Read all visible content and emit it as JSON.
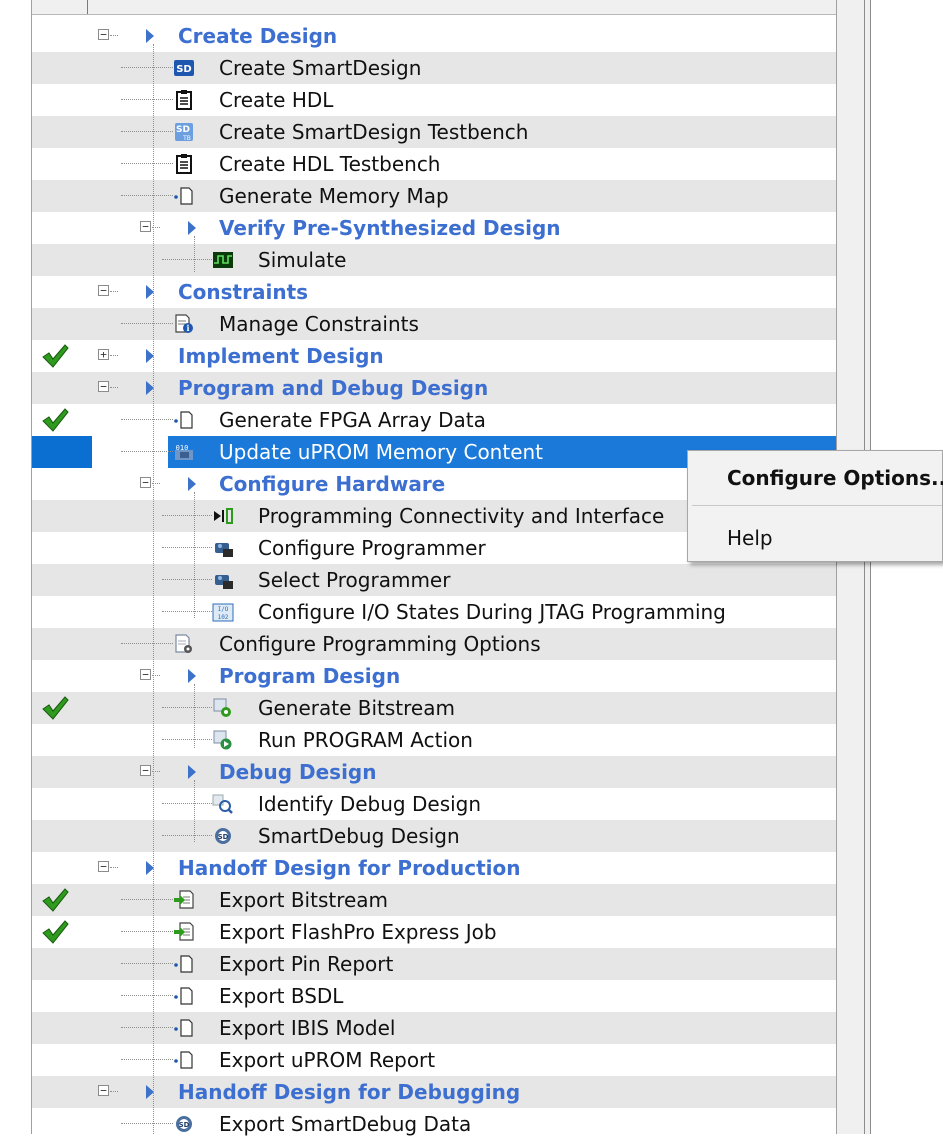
{
  "tree": {
    "rows": [
      {
        "id": "create-design",
        "label": "Create Design",
        "kind": "group",
        "icon": "caret-right-icon",
        "expander": "minus",
        "check": false
      },
      {
        "id": "create-smartdesign",
        "label": "Create SmartDesign",
        "kind": "item",
        "icon": "smartdesign-icon",
        "check": false
      },
      {
        "id": "create-hdl",
        "label": "Create HDL",
        "kind": "item",
        "icon": "clipboard-icon",
        "check": false
      },
      {
        "id": "create-smartdesign-testbench",
        "label": "Create SmartDesign Testbench",
        "kind": "item",
        "icon": "smartdesign-testbench-icon",
        "check": false
      },
      {
        "id": "create-hdl-testbench",
        "label": "Create HDL Testbench",
        "kind": "item",
        "icon": "clipboard-icon",
        "check": false
      },
      {
        "id": "generate-memory-map",
        "label": "Generate Memory Map",
        "kind": "item",
        "icon": "blank-doc-icon",
        "check": false
      },
      {
        "id": "verify-pre-synthesized-design",
        "label": "Verify Pre-Synthesized Design",
        "kind": "group",
        "icon": "caret-right-icon",
        "expander": "minus",
        "check": false
      },
      {
        "id": "simulate",
        "label": "Simulate",
        "kind": "item",
        "icon": "waveform-icon",
        "check": false
      },
      {
        "id": "constraints",
        "label": "Constraints",
        "kind": "group",
        "icon": "caret-right-icon",
        "expander": "minus",
        "check": false
      },
      {
        "id": "manage-constraints",
        "label": "Manage Constraints",
        "kind": "item",
        "icon": "document-info-icon",
        "check": false
      },
      {
        "id": "implement-design",
        "label": "Implement Design",
        "kind": "group",
        "icon": "caret-right-icon",
        "expander": "plus",
        "check": true
      },
      {
        "id": "program-and-debug-design",
        "label": "Program and Debug Design",
        "kind": "group",
        "icon": "caret-right-icon",
        "expander": "minus",
        "check": false
      },
      {
        "id": "generate-fpga-array-data",
        "label": "Generate FPGA Array Data",
        "kind": "item",
        "icon": "blank-doc-icon",
        "check": true
      },
      {
        "id": "update-uprom-memory-content",
        "label": "Update uPROM Memory Content",
        "kind": "item",
        "icon": "binary-chip-icon",
        "check": false,
        "selected": true
      },
      {
        "id": "configure-hardware",
        "label": "Configure Hardware",
        "kind": "group",
        "icon": "caret-right-icon",
        "expander": "minus",
        "check": false
      },
      {
        "id": "programming-connectivity",
        "label": "Programming Connectivity and Interface",
        "kind": "item",
        "icon": "connectivity-icon",
        "check": false
      },
      {
        "id": "configure-programmer",
        "label": "Configure Programmer",
        "kind": "item",
        "icon": "programmer-icon",
        "check": false
      },
      {
        "id": "select-programmer",
        "label": "Select Programmer",
        "kind": "item",
        "icon": "programmer-icon",
        "check": false
      },
      {
        "id": "configure-io-states",
        "label": "Configure I/O States During JTAG Programming",
        "kind": "item",
        "icon": "io-states-icon",
        "check": false
      },
      {
        "id": "configure-programming-options",
        "label": "Configure Programming Options",
        "kind": "item",
        "icon": "settings-doc-icon",
        "check": false
      },
      {
        "id": "program-design",
        "label": "Program Design",
        "kind": "group",
        "icon": "caret-right-icon",
        "expander": "minus",
        "check": false
      },
      {
        "id": "generate-bitstream",
        "label": "Generate Bitstream",
        "kind": "item",
        "icon": "bitstream-gear-icon",
        "check": true
      },
      {
        "id": "run-program-action",
        "label": "Run PROGRAM Action",
        "kind": "item",
        "icon": "run-action-icon",
        "check": false
      },
      {
        "id": "debug-design",
        "label": "Debug Design",
        "kind": "group",
        "icon": "caret-right-icon",
        "expander": "minus",
        "check": false
      },
      {
        "id": "identify-debug-design",
        "label": "Identify Debug Design",
        "kind": "item",
        "icon": "magnifier-icon",
        "check": false
      },
      {
        "id": "smartdebug-design",
        "label": "SmartDebug Design",
        "kind": "item",
        "icon": "smartdebug-icon",
        "check": false
      },
      {
        "id": "handoff-design-for-production",
        "label": "Handoff Design for Production",
        "kind": "group",
        "icon": "caret-right-icon",
        "expander": "minus",
        "check": false
      },
      {
        "id": "export-bitstream",
        "label": "Export Bitstream",
        "kind": "item",
        "icon": "export-icon",
        "check": true
      },
      {
        "id": "export-flashpro-express-job",
        "label": "Export FlashPro Express Job",
        "kind": "item",
        "icon": "export-icon",
        "check": true
      },
      {
        "id": "export-pin-report",
        "label": "Export Pin Report",
        "kind": "item",
        "icon": "blank-doc-icon",
        "check": false
      },
      {
        "id": "export-bsdl",
        "label": "Export BSDL",
        "kind": "item",
        "icon": "blank-doc-icon",
        "check": false
      },
      {
        "id": "export-ibis-model",
        "label": "Export IBIS Model",
        "kind": "item",
        "icon": "blank-doc-icon",
        "check": false
      },
      {
        "id": "export-uprom-report",
        "label": "Export uPROM Report",
        "kind": "item",
        "icon": "blank-doc-icon",
        "check": false
      },
      {
        "id": "handoff-design-for-debugging",
        "label": "Handoff Design for Debugging",
        "kind": "group",
        "icon": "caret-right-icon",
        "expander": "minus",
        "check": false
      },
      {
        "id": "export-smartdebug-data",
        "label": "Export SmartDebug Data",
        "kind": "item",
        "icon": "smartdebug-icon",
        "check": false
      }
    ]
  },
  "context_menu": {
    "items": [
      {
        "label": "Configure Options..."
      },
      {
        "label": "Help"
      }
    ]
  },
  "colors": {
    "group_text": "#3c6fd0",
    "selection": "#1b79d9",
    "check": "#2e9a1e"
  }
}
